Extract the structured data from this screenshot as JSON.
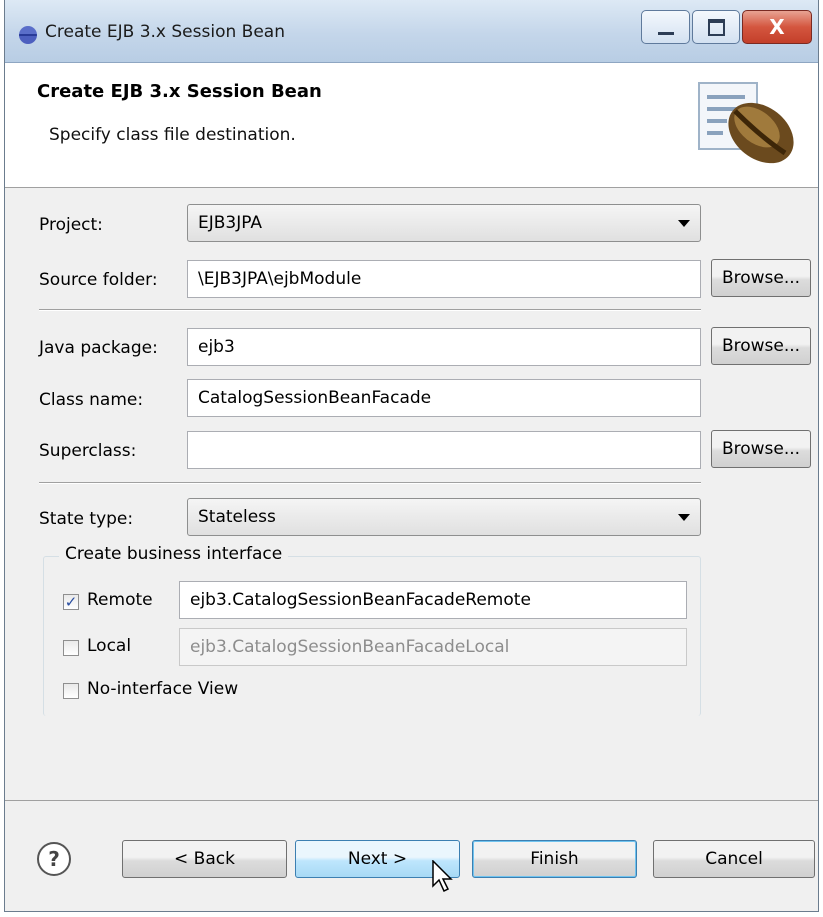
{
  "window": {
    "title": "Create EJB 3.x Session Bean",
    "close_glyph": "X"
  },
  "banner": {
    "title": "Create EJB 3.x Session Bean",
    "description": "Specify class file destination."
  },
  "form": {
    "project_label": "Project:",
    "project_value": "EJB3JPA",
    "source_folder_label": "Source folder:",
    "source_folder_value": "\\EJB3JPA\\ejbModule",
    "java_package_label": "Java package:",
    "java_package_value": "ejb3",
    "class_name_label": "Class name:",
    "class_name_value": "CatalogSessionBeanFacade",
    "superclass_label": "Superclass:",
    "superclass_value": "",
    "browse_label": "Browse...",
    "state_type_label": "State type:",
    "state_type_value": "Stateless"
  },
  "business_interface": {
    "group_label": "Create business interface",
    "remote_label": "Remote",
    "remote_checked": true,
    "remote_value": "ejb3.CatalogSessionBeanFacadeRemote",
    "local_label": "Local",
    "local_checked": false,
    "local_value": "ejb3.CatalogSessionBeanFacadeLocal",
    "no_interface_label": "No-interface View",
    "no_interface_checked": false,
    "check_glyph": "✓"
  },
  "footer": {
    "help_glyph": "?",
    "back_label": "< Back",
    "next_label": "Next >",
    "finish_label": "Finish",
    "cancel_label": "Cancel"
  }
}
